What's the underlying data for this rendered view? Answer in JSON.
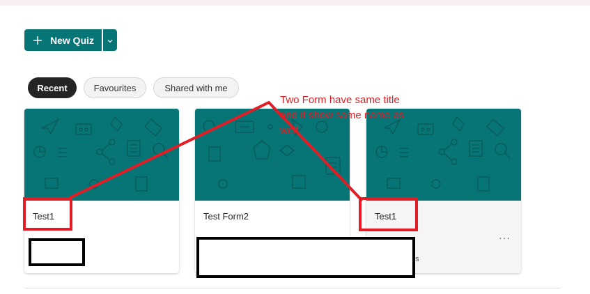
{
  "toolbar": {
    "new_quiz_label": "New Quiz"
  },
  "filters": {
    "recent": "Recent",
    "favourites": "Favourites",
    "shared": "Shared with me"
  },
  "cards": [
    {
      "title": "Test1"
    },
    {
      "title": "Test Form2"
    },
    {
      "title": "Test1",
      "more": "···",
      "meta_partial": "es"
    }
  ],
  "annotation": {
    "text": "Two Form have same title and it show same name as well",
    "color": "#e31d25"
  },
  "colors": {
    "accent": "#077575",
    "pill_active": "#242424"
  }
}
